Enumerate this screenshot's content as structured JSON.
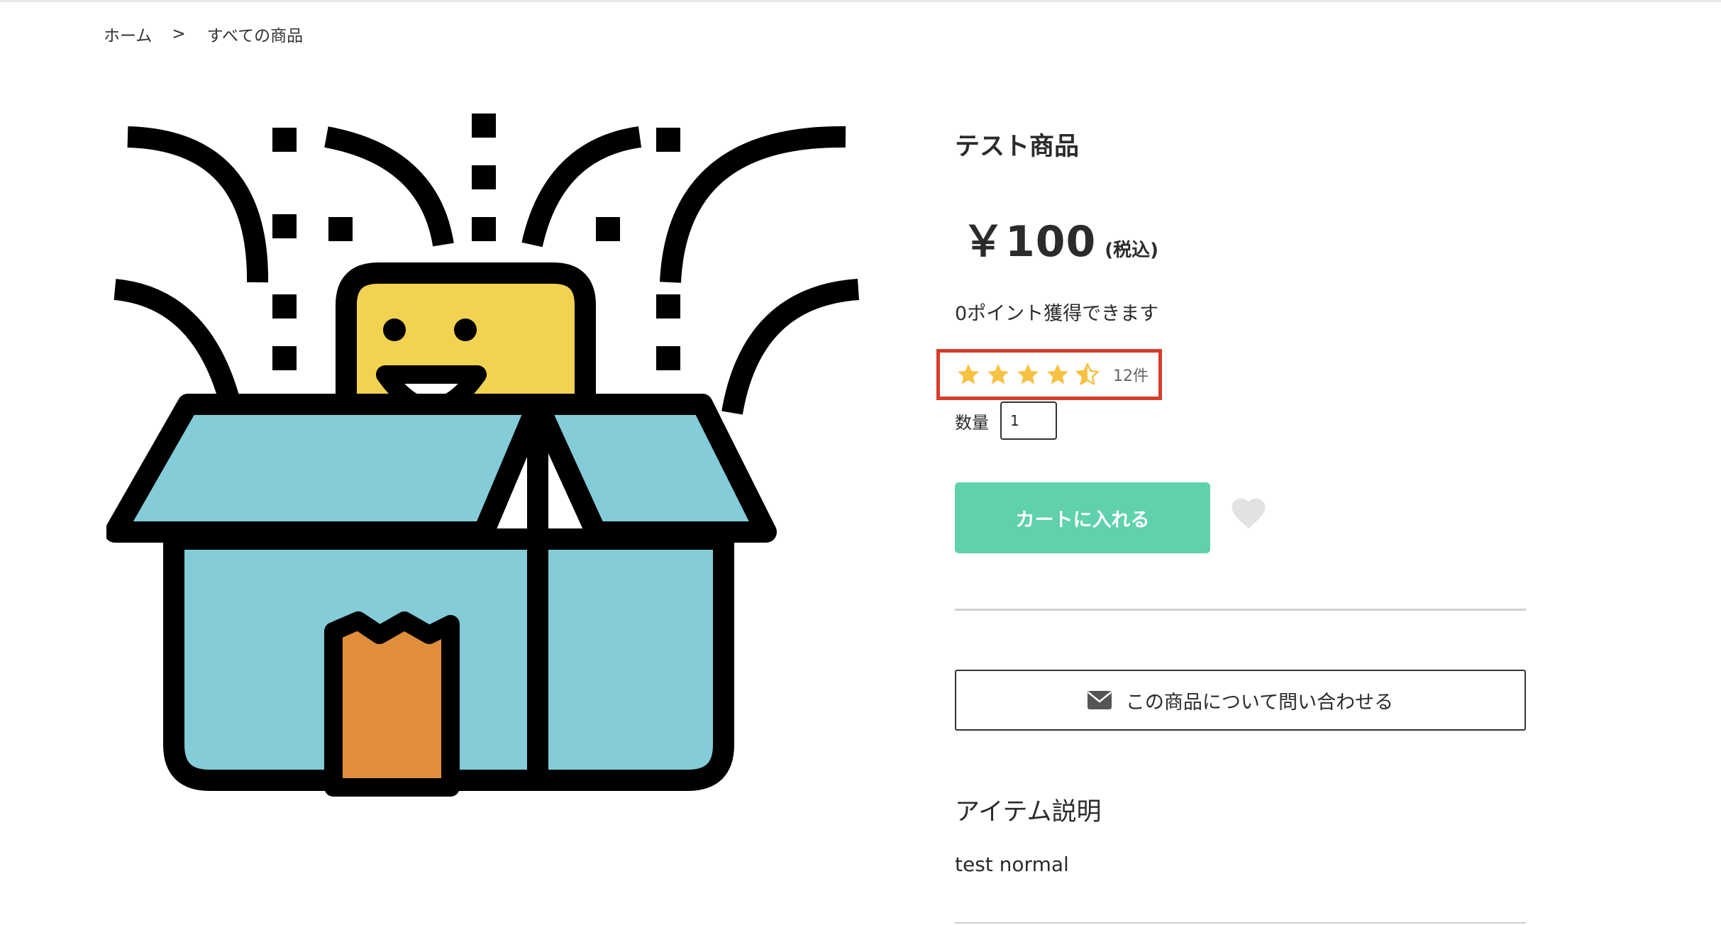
{
  "breadcrumb": {
    "home": "ホーム",
    "separator": ">",
    "current": "すべての商品"
  },
  "product": {
    "image_icon": "surprise-box-icon",
    "title": "テスト商品",
    "price": "￥100",
    "tax_note": "(税込)",
    "points": "0ポイント獲得できます",
    "rating": {
      "value": 4.5,
      "max": 5,
      "count": "12件",
      "highlight_color": "#d73c28",
      "star_color": "#f7c142"
    },
    "quantity": {
      "label": "数量",
      "value": "1"
    },
    "cart_button": "カートに入れる",
    "cart_button_color": "#5fd1ab",
    "favorite_icon": "heart-icon",
    "contact_button": "この商品について問い合わせる",
    "contact_icon": "envelope-icon",
    "description": {
      "heading": "アイテム説明",
      "text": "test normal"
    }
  }
}
